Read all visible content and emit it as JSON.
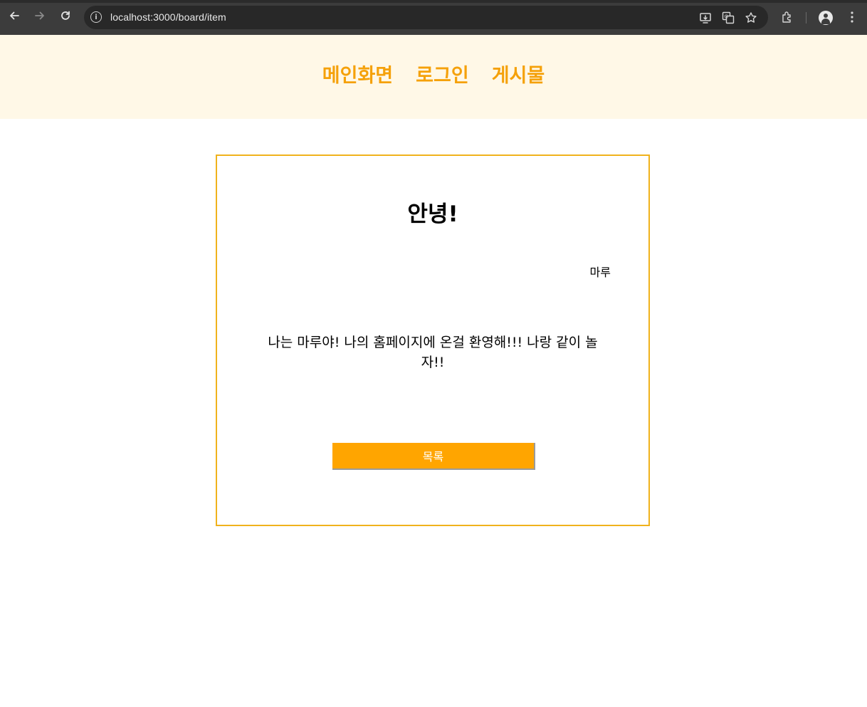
{
  "browser": {
    "url": "localhost:3000/board/item",
    "info_icon_glyph": "i",
    "back_icon": "arrow-left-icon",
    "forward_icon": "arrow-right-icon",
    "reload_icon": "reload-icon"
  },
  "nav": {
    "items": [
      {
        "label": "메인화면"
      },
      {
        "label": "로그인"
      },
      {
        "label": "게시물"
      }
    ],
    "color": "#f5a10a",
    "header_bg": "#fff8e7"
  },
  "post": {
    "title": "안녕!",
    "author": "마루",
    "content": "나는 마루야! 나의 홈페이지에 온걸 환영해!!! 나랑 같이 놀자!!",
    "list_button_label": "목록",
    "border_color": "#f0b21c",
    "button_color": "#ffa500"
  }
}
